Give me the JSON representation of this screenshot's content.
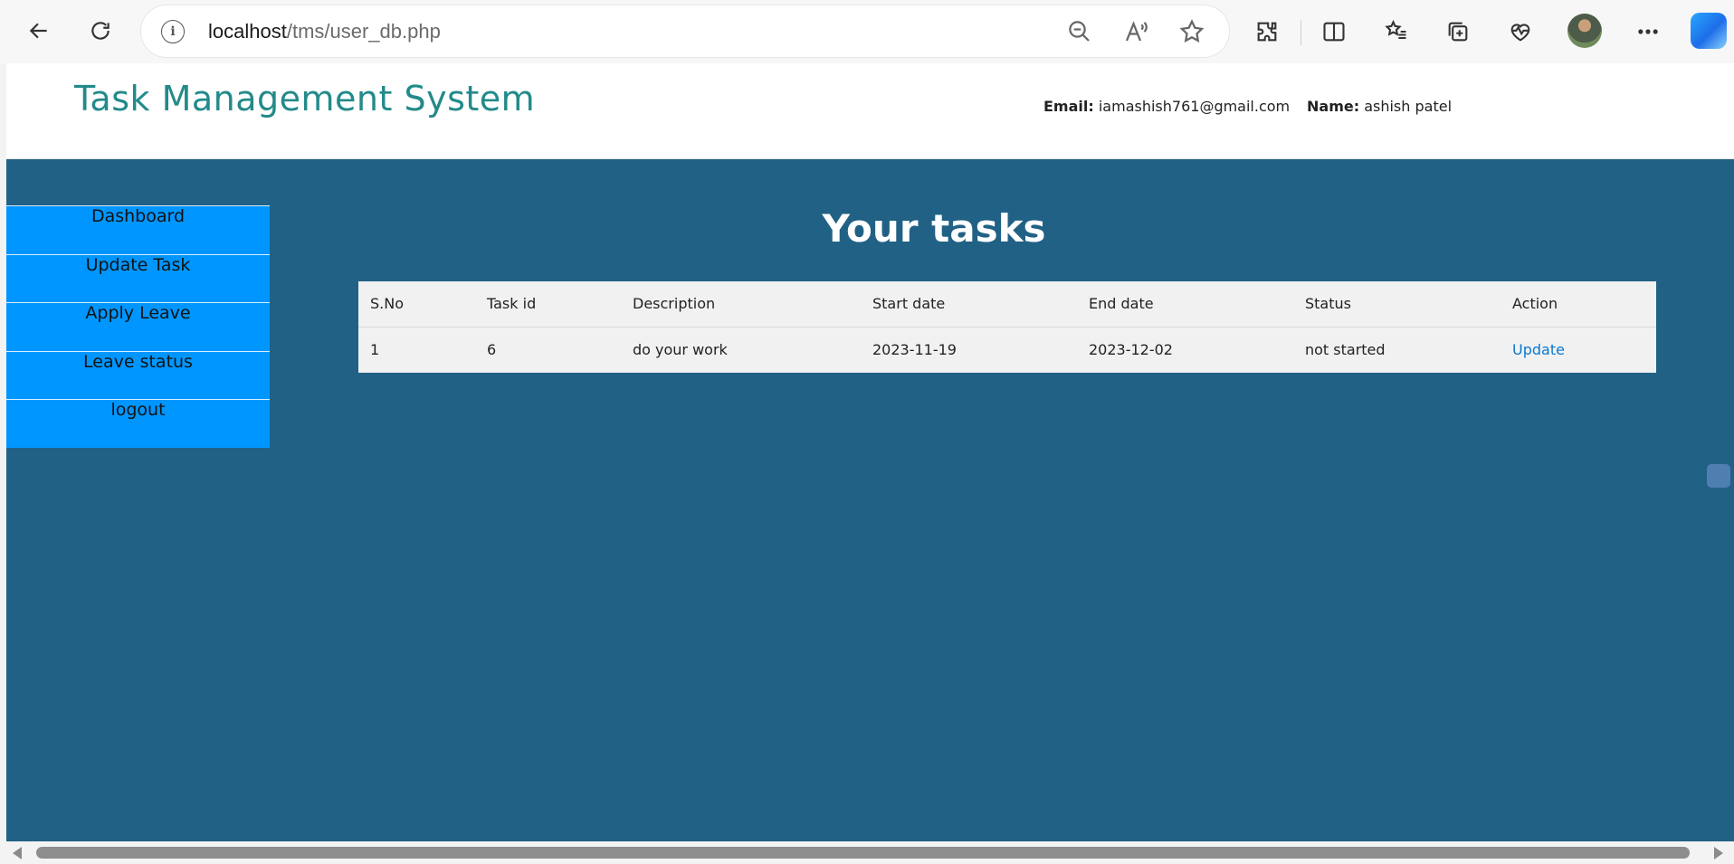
{
  "browser": {
    "url_host": "localhost",
    "url_path": "/tms/user_db.php"
  },
  "header": {
    "title": "Task Management System",
    "email_label": "Email:",
    "email_value": "iamashish761@gmail.com",
    "name_label": "Name:",
    "name_value": "ashish patel"
  },
  "sidebar": {
    "items": [
      {
        "label": "Dashboard"
      },
      {
        "label": "Update Task"
      },
      {
        "label": "Apply Leave"
      },
      {
        "label": "Leave status"
      },
      {
        "label": "logout"
      }
    ]
  },
  "main": {
    "heading": "Your tasks",
    "table": {
      "columns": [
        "S.No",
        "Task id",
        "Description",
        "Start date",
        "End date",
        "Status",
        "Action"
      ],
      "rows": [
        {
          "sno": "1",
          "task_id": "6",
          "description": "do your work",
          "start_date": "2023-11-19",
          "end_date": "2023-12-02",
          "status": "not started",
          "action": "Update"
        }
      ]
    }
  },
  "colors": {
    "title": "#238a8a",
    "main_bg": "#216185",
    "sidebar_bg": "#0096ff",
    "link": "#0b78d0"
  }
}
